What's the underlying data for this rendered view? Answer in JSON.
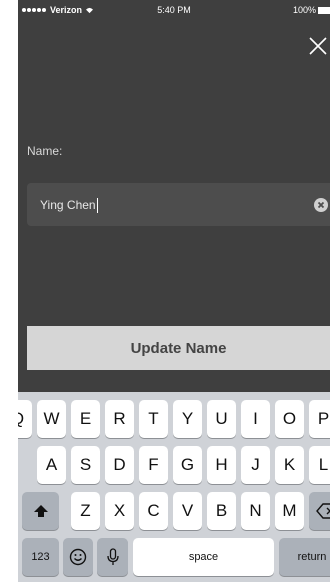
{
  "status_bar": {
    "carrier": "Verizon",
    "time": "5:40 PM",
    "battery": "100%"
  },
  "form": {
    "label": "Name:",
    "value": "Ying Chen",
    "submit_label": "Update Name"
  },
  "keyboard": {
    "row1": [
      "Q",
      "W",
      "E",
      "R",
      "T",
      "Y",
      "U",
      "I",
      "O",
      "P"
    ],
    "row2": [
      "A",
      "S",
      "D",
      "F",
      "G",
      "H",
      "J",
      "K",
      "L"
    ],
    "row3": [
      "Z",
      "X",
      "C",
      "V",
      "B",
      "N",
      "M"
    ],
    "numbers_label": "123",
    "space_label": "space",
    "return_label": "return"
  },
  "colors": {
    "background": "#3f3f3f",
    "field": "#4d4d4d",
    "button": "#d6d6d6",
    "keyboard": "#cfd2d7"
  }
}
